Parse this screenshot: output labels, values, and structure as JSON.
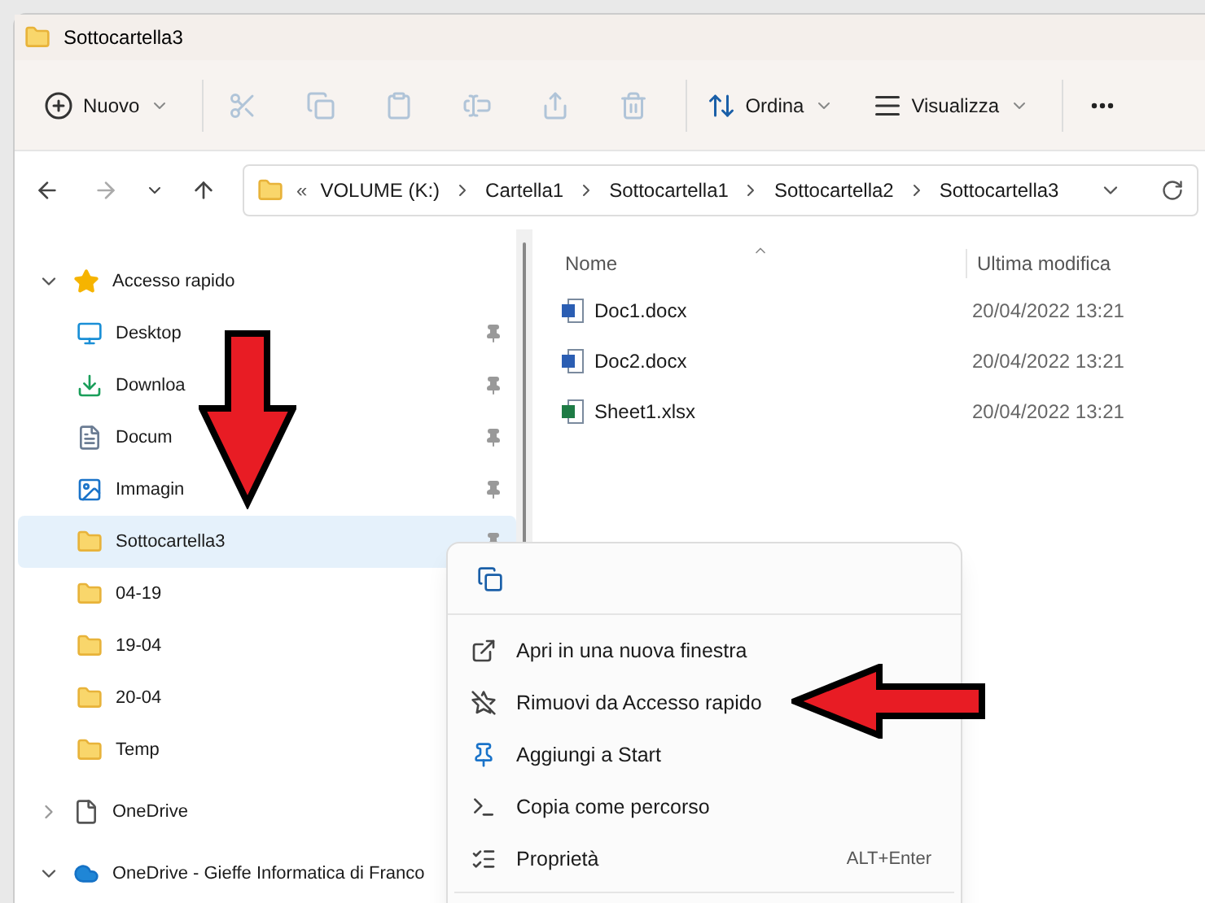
{
  "window": {
    "title": "Sottocartella3"
  },
  "toolbar": {
    "items": [
      {
        "kind": "new",
        "label": "Nuovo",
        "disabled": false
      },
      {
        "kind": "cut",
        "disabled": true
      },
      {
        "kind": "copy",
        "disabled": true
      },
      {
        "kind": "paste",
        "disabled": true
      },
      {
        "kind": "rename",
        "disabled": true
      },
      {
        "kind": "share",
        "disabled": true
      },
      {
        "kind": "delete",
        "disabled": true
      },
      {
        "kind": "sort",
        "label": "Ordina",
        "disabled": false
      },
      {
        "kind": "view",
        "label": "Visualizza",
        "disabled": false
      },
      {
        "kind": "more",
        "disabled": false
      }
    ]
  },
  "address": {
    "prefix": "«",
    "path": [
      "VOLUME (K:)",
      "Cartella1",
      "Sottocartella1",
      "Sottocartella2",
      "Sottocartella3"
    ]
  },
  "sidebar": {
    "items": [
      {
        "kind": "star",
        "label": "Accesso rapido",
        "expanded": true,
        "children": [
          {
            "kind": "desktop",
            "label": "Desktop",
            "pinned": true,
            "selected": false
          },
          {
            "kind": "download",
            "label": "Downloa",
            "pinned": true,
            "selected": false
          },
          {
            "kind": "document",
            "label": "Docum",
            "pinned": true,
            "selected": false
          },
          {
            "kind": "image",
            "label": "Immagin",
            "pinned": true,
            "selected": false
          },
          {
            "kind": "folder",
            "label": "Sottocartella3",
            "pinned": true,
            "selected": true
          },
          {
            "kind": "folder",
            "label": "04-19",
            "pinned": false,
            "selected": false
          },
          {
            "kind": "folder",
            "label": "19-04",
            "pinned": false,
            "selected": false
          },
          {
            "kind": "folder",
            "label": "20-04",
            "pinned": false,
            "selected": false
          },
          {
            "kind": "folder",
            "label": "Temp",
            "pinned": false,
            "selected": false
          }
        ]
      },
      {
        "kind": "file",
        "label": "OneDrive",
        "expanded": false
      },
      {
        "kind": "cloud",
        "label": "OneDrive - Gieffe Informatica di Franco",
        "expanded": true
      }
    ]
  },
  "table": {
    "columns": [
      "Nome",
      "Ultima modifica"
    ],
    "rows": [
      {
        "kind": "word",
        "name": "Doc1.docx",
        "modified": "20/04/2022 13:21"
      },
      {
        "kind": "word",
        "name": "Doc2.docx",
        "modified": "20/04/2022 13:21"
      },
      {
        "kind": "excel",
        "name": "Sheet1.xlsx",
        "modified": "20/04/2022 13:21"
      }
    ]
  },
  "context_menu": {
    "top_actions": [
      {
        "kind": "copy"
      }
    ],
    "items": [
      {
        "kind": "open",
        "label": "Apri in una nuova finestra"
      },
      {
        "kind": "unpin",
        "label": "Rimuovi da Accesso rapido"
      },
      {
        "kind": "pin",
        "label": "Aggiungi a Start"
      },
      {
        "kind": "path",
        "label": "Copia come percorso"
      },
      {
        "kind": "properties",
        "label": "Proprietà",
        "shortcut": "ALT+Enter"
      }
    ]
  }
}
